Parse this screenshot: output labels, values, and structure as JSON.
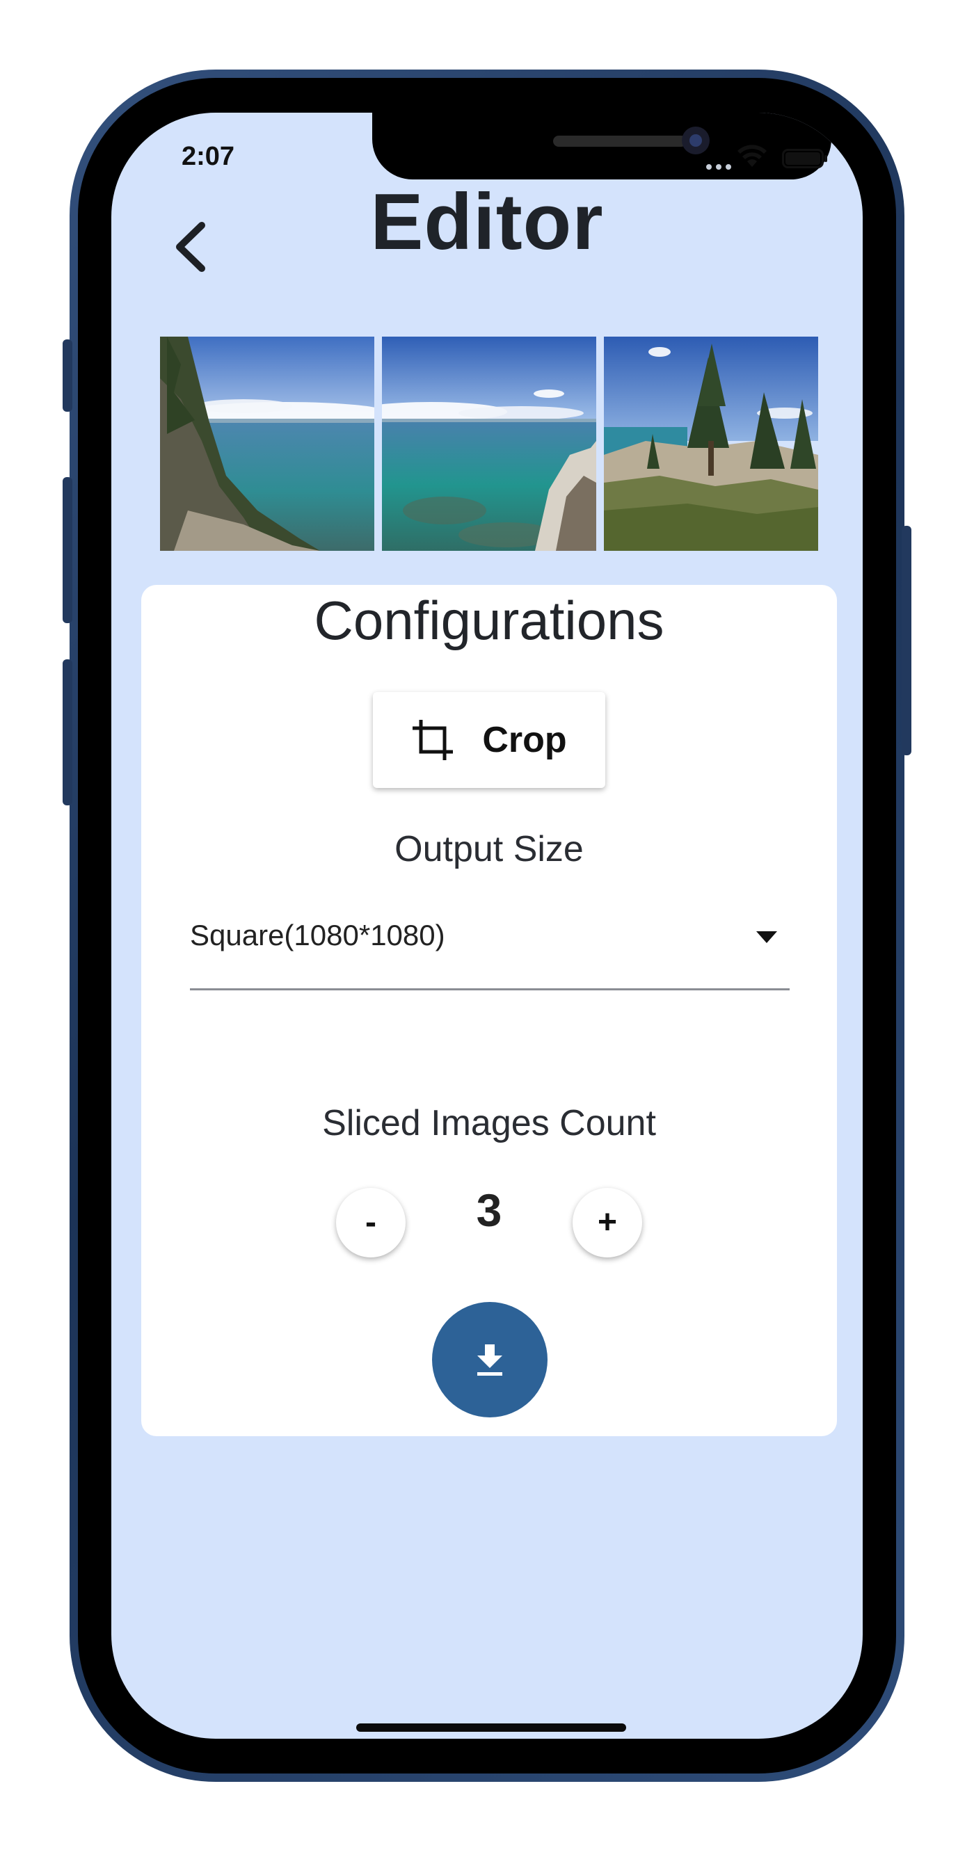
{
  "status_bar": {
    "time": "2:07",
    "icons": [
      "signal-dots-icon",
      "wifi-icon",
      "battery-icon"
    ]
  },
  "header": {
    "title": "Editor",
    "back_icon": "chevron-left-icon"
  },
  "preview": {
    "slices_shown": 3,
    "description_icons": [
      "lake-slice-left",
      "lake-slice-middle",
      "lake-slice-right"
    ]
  },
  "config": {
    "heading": "Configurations",
    "crop_label": "Crop",
    "crop_icon": "crop-icon",
    "output_size_label": "Output Size",
    "output_size_value": "Square(1080*1080)",
    "output_size_caret_icon": "dropdown-caret-icon",
    "sliced_count_label": "Sliced Images Count",
    "decrement_label": "-",
    "count_value": "3",
    "increment_label": "+",
    "download_icon": "download-icon"
  },
  "colors": {
    "screen_background": "#d4e3fc",
    "card_background": "#ffffff",
    "accent": "#2d6297",
    "frame": "#1c3357"
  }
}
